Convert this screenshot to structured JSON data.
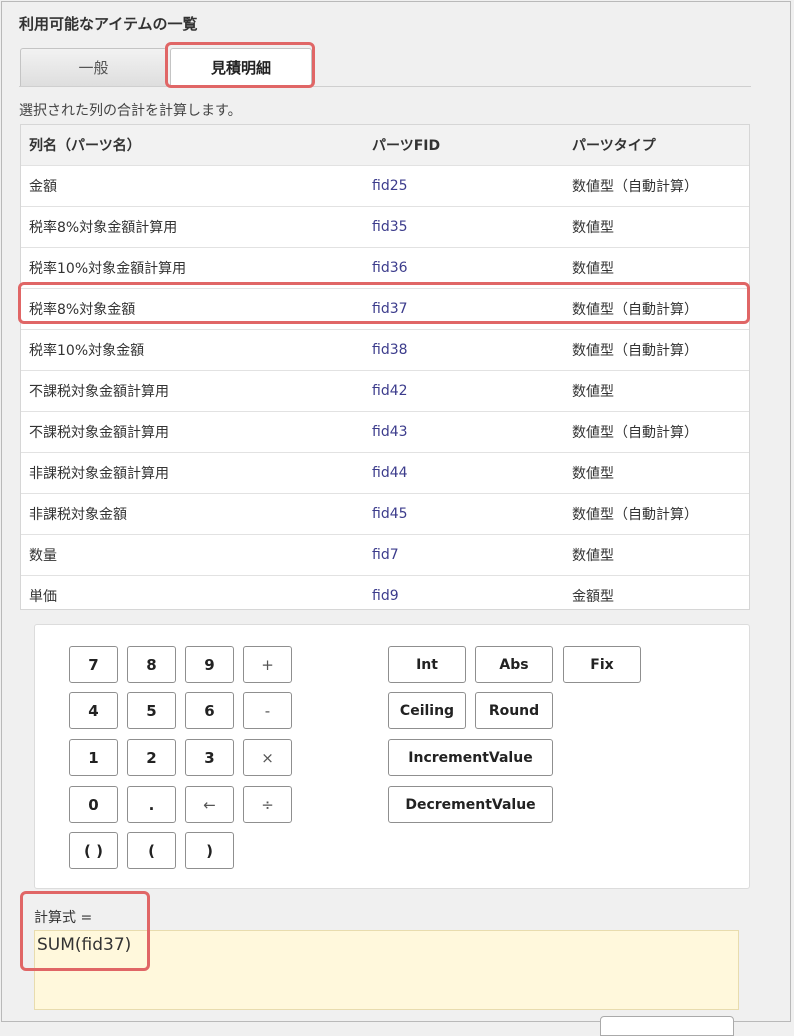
{
  "panel": {
    "title": "利用可能なアイテムの一覧"
  },
  "tabs": [
    {
      "label": "一般"
    },
    {
      "label": "見積明細"
    }
  ],
  "description": "選択された列の合計を計算します。",
  "table": {
    "headers": [
      "列名（パーツ名）",
      "パーツFID",
      "パーツタイプ"
    ],
    "rows": [
      {
        "name": "金額",
        "fid": "fid25",
        "type": "数値型（自動計算）"
      },
      {
        "name": "税率8%対象金額計算用",
        "fid": "fid35",
        "type": "数値型"
      },
      {
        "name": "税率10%対象金額計算用",
        "fid": "fid36",
        "type": "数値型"
      },
      {
        "name": "税率8%対象金額",
        "fid": "fid37",
        "type": "数値型（自動計算）"
      },
      {
        "name": "税率10%対象金額",
        "fid": "fid38",
        "type": "数値型（自動計算）"
      },
      {
        "name": "不課税対象金額計算用",
        "fid": "fid42",
        "type": "数値型"
      },
      {
        "name": "不課税対象金額計算用",
        "fid": "fid43",
        "type": "数値型（自動計算）"
      },
      {
        "name": "非課税対象金額計算用",
        "fid": "fid44",
        "type": "数値型"
      },
      {
        "name": "非課税対象金額",
        "fid": "fid45",
        "type": "数値型（自動計算）"
      },
      {
        "name": "数量",
        "fid": "fid7",
        "type": "数値型"
      },
      {
        "name": "単価",
        "fid": "fid9",
        "type": "金額型"
      }
    ]
  },
  "keypad": {
    "rows": [
      [
        "7",
        "8",
        "9",
        "+"
      ],
      [
        "4",
        "5",
        "6",
        "-"
      ],
      [
        "1",
        "2",
        "3",
        "×"
      ],
      [
        "0",
        ".",
        "←",
        "÷"
      ],
      [
        "( )",
        "(",
        ")"
      ]
    ]
  },
  "functions": {
    "rows": [
      [
        "Int",
        "Abs",
        "Fix"
      ],
      [
        "Ceiling",
        "Round"
      ],
      [
        "IncrementValue"
      ],
      [
        "DecrementValue"
      ]
    ]
  },
  "formula": {
    "label": "計算式 =",
    "value": "SUM(fid37)"
  },
  "colors": {
    "highlight": "#e06666",
    "fid_link": "#3c3c8c",
    "formula_bg": "#fff8dc"
  }
}
